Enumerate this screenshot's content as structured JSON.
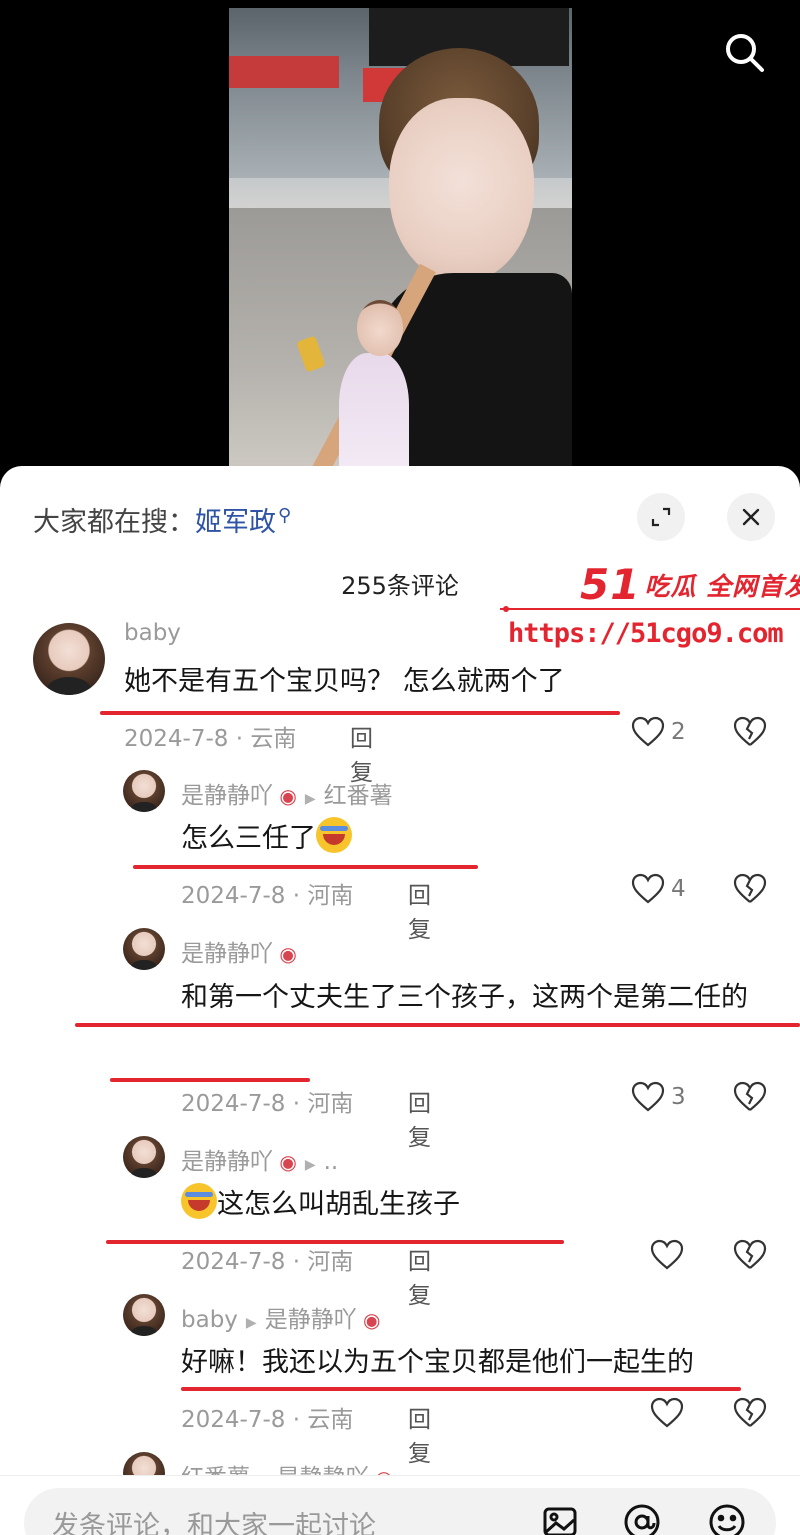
{
  "video": {
    "search_icon": "search-icon"
  },
  "sheet": {
    "hot_search_prefix": "大家都在搜：",
    "hot_search_keyword": "姬军政",
    "expand_icon": "expand-icon",
    "close_icon": "close-icon",
    "comment_count": "255条评论"
  },
  "watermark": {
    "number": "51",
    "title": "吃瓜 全网首发",
    "url": "https://51cgo9.com"
  },
  "comments": [
    {
      "user": "baby",
      "reply_to": "",
      "text": "她不是有五个宝贝吗？ 怎么就两个了",
      "date_loc": "2024-7-8 · 云南",
      "reply_label": "回复",
      "likes": "2"
    },
    {
      "user": "是静静吖",
      "reply_to": "红番薯",
      "text": "怎么三任了",
      "date_loc": "2024-7-8 · 河南",
      "reply_label": "回复",
      "likes": "4"
    },
    {
      "user": "是静静吖",
      "reply_to": "",
      "text": "和第一个丈夫生了三个孩子，这两个是第二任的",
      "date_loc": "2024-7-8 · 河南",
      "reply_label": "回复",
      "likes": "3"
    },
    {
      "user": "是静静吖",
      "reply_to": "..",
      "text": "这怎么叫胡乱生孩子",
      "date_loc": "2024-7-8 · 河南",
      "reply_label": "回复",
      "likes": ""
    },
    {
      "user": "baby",
      "reply_to": "是静静吖",
      "text": "好嘛！我还以为五个宝贝都是他们一起生的",
      "date_loc": "2024-7-8 · 云南",
      "reply_label": "回复",
      "likes": ""
    },
    {
      "user": "红番薯",
      "reply_to": "是静静吖",
      "text": "",
      "date_loc": "",
      "reply_label": "",
      "likes": ""
    }
  ],
  "bottom": {
    "placeholder": "发条评论，和大家一起讨论",
    "image_icon": "image-icon",
    "mention_icon": "at-icon",
    "emoji_icon": "emoji-icon"
  },
  "colors": {
    "accent_blue": "#2f54a6",
    "watermark_red": "#e3252f",
    "underline_red": "#e3252f"
  }
}
